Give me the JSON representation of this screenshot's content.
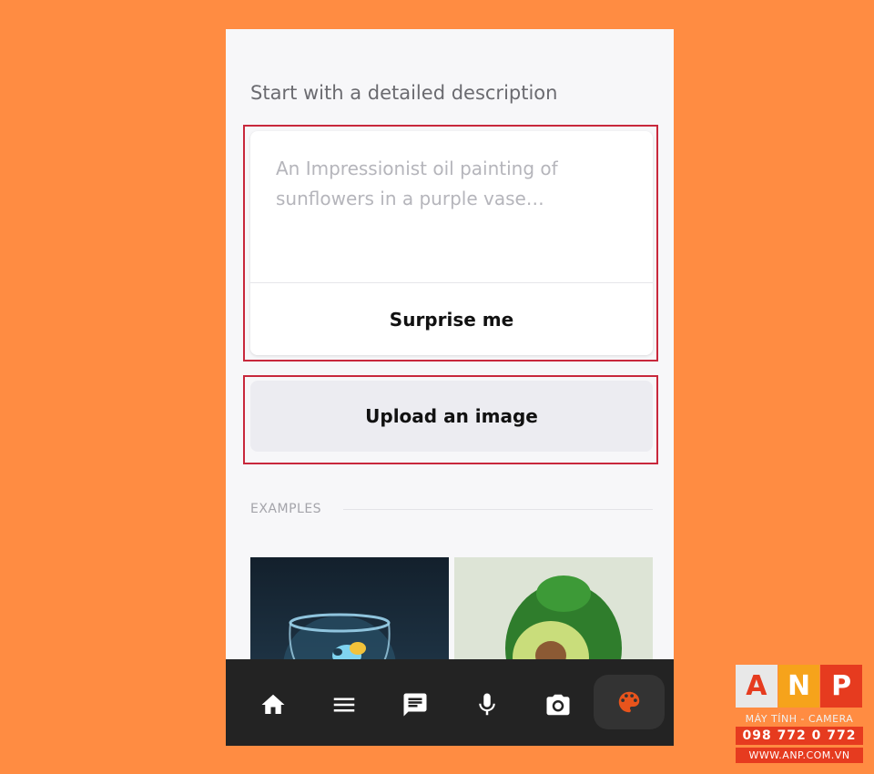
{
  "prompt": {
    "heading": "Start with a detailed description",
    "placeholder": "An Impressionist oil painting of sunflowers in a purple vase…",
    "surprise_label": "Surprise me"
  },
  "upload": {
    "label": "Upload an image"
  },
  "examples": {
    "label": "EXAMPLES"
  },
  "nav": {
    "items": [
      "home-icon",
      "menu-icon",
      "chat-icon",
      "microphone-icon",
      "camera-icon",
      "palette-icon"
    ],
    "active": "palette-icon"
  },
  "watermark": {
    "letters": [
      "A",
      "N",
      "P"
    ],
    "colors": [
      "#e8e8e8",
      "#f6a31b",
      "#e63b1f"
    ],
    "subtitle": "MÁY TÍNH - CAMERA",
    "phone": "098 772 0 772",
    "website": "WWW.ANP.COM.VN"
  },
  "colors": {
    "background": "#FF8C42",
    "highlight": "#c8283c",
    "active_icon": "#e8541c",
    "nav_bar": "#232323"
  }
}
